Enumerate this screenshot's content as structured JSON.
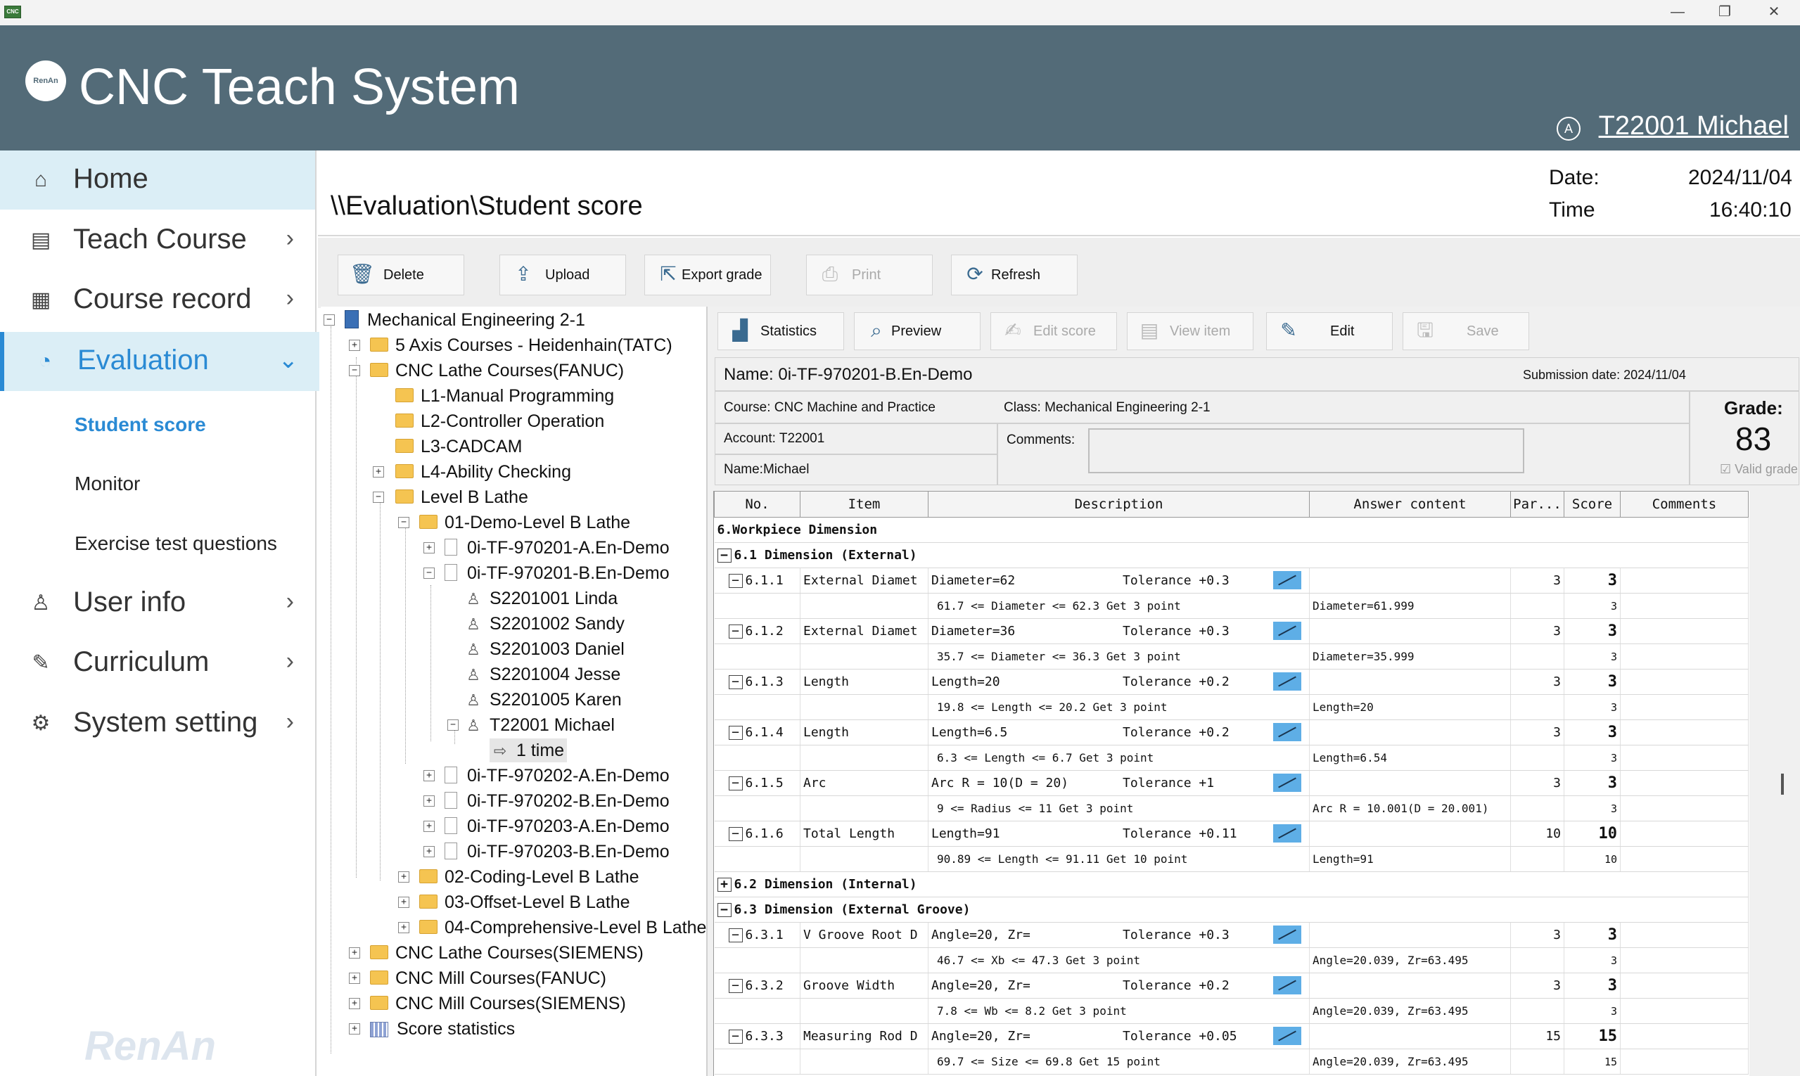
{
  "window": {
    "app_icon": "CNC",
    "minimize": "—",
    "restore": "❐",
    "close": "✕"
  },
  "header": {
    "title": "CNC Teach System",
    "logo_text": "RenAn",
    "user": "T22001 Michael",
    "user_icon": "A"
  },
  "sidebar": {
    "items": [
      {
        "label": "Home",
        "icon": "home-icon"
      },
      {
        "label": "Teach Course",
        "icon": "cnc-icon"
      },
      {
        "label": "Course record",
        "icon": "document-icon"
      },
      {
        "label": "Evaluation",
        "icon": "pie-chart-icon"
      },
      {
        "label": "User info",
        "icon": "user-icon"
      },
      {
        "label": "Curriculum",
        "icon": "pencil-icon"
      },
      {
        "label": "System setting",
        "icon": "gear-icon"
      }
    ],
    "sub_items": [
      "Student score",
      "Monitor",
      "Exercise test questions"
    ],
    "watermark": "RenAn"
  },
  "pathbar": {
    "path": "\\\\Evaluation\\Student score",
    "date_label": "Date:",
    "date_value": "2024/11/04",
    "time_label": "Time",
    "time_value": "16:40:10"
  },
  "toolbar": {
    "delete": "Delete",
    "upload": "Upload",
    "export": "Export grade",
    "print": "Print",
    "refresh": "Refresh"
  },
  "tree": {
    "root": "Mechanical Engineering 2-1",
    "n1": "5 Axis Courses - Heidenhain(TATC)",
    "n2": "CNC Lathe Courses(FANUC)",
    "n3": "L1-Manual Programming",
    "n4": "L2-Controller Operation",
    "n5": "L3-CADCAM",
    "n6": "L4-Ability Checking",
    "n7": "Level B Lathe",
    "n8": "01-Demo-Level B Lathe",
    "n9": "0i-TF-970201-A.En-Demo",
    "n10": "0i-TF-970201-B.En-Demo",
    "s1": "S2201001 Linda",
    "s2": "S2201002 Sandy",
    "s3": "S2201003 Daniel",
    "s4": "S2201004 Jesse",
    "s5": "S2201005 Karen",
    "s6": "T22001 Michael",
    "t1": "1 time",
    "n11": "0i-TF-970202-A.En-Demo",
    "n12": "0i-TF-970202-B.En-Demo",
    "n13": "0i-TF-970203-A.En-Demo",
    "n14": "0i-TF-970203-B.En-Demo",
    "n15": "02-Coding-Level B Lathe",
    "n16": "03-Offset-Level B Lathe",
    "n17": "04-Comprehensive-Level B Lathe",
    "n18": "CNC Lathe Courses(SIEMENS)",
    "n19": "CNC Mill Courses(FANUC)",
    "n20": "CNC Mill Courses(SIEMENS)",
    "n21": "Score statistics"
  },
  "right_toolbar": {
    "statistics": "Statistics",
    "preview": "Preview",
    "edit_score": "Edit score",
    "view_item": "View item",
    "edit": "Edit",
    "save": "Save"
  },
  "info": {
    "name": "Name: 0i-TF-970201-B.En-Demo",
    "submission": "Submission date: 2024/11/04",
    "course": "Course: CNC Machine and Practice",
    "class": "Class: Mechanical Engineering 2-1",
    "account": "Account: T22001",
    "comments_label": "Comments:",
    "student_name": "Name:Michael",
    "grade_label": "Grade:",
    "grade_value": "83",
    "valid_grade": "Valid grade"
  },
  "table": {
    "headers": [
      "No.",
      "Item",
      "Description",
      "Answer content",
      "Par...",
      "Score",
      "Comments"
    ],
    "section_6": "6.Workpiece Dimension",
    "section_61": "6.1 Dimension (External)",
    "section_62": "6.2 Dimension (Internal)",
    "section_63": "6.3 Dimension (External Groove)",
    "rows": [
      {
        "no": "6.1.1",
        "item": "External Diamet",
        "desc": "Diameter=62",
        "tol": "Tolerance +0.3",
        "par": "3",
        "score": "3",
        "sub": "61.7 <= Diameter <= 62.3 Get 3 point",
        "answer": "Diameter=61.999",
        "subscore": "3"
      },
      {
        "no": "6.1.2",
        "item": "External Diamet",
        "desc": "Diameter=36",
        "tol": "Tolerance +0.3",
        "par": "3",
        "score": "3",
        "sub": "35.7 <= Diameter <= 36.3 Get 3 point",
        "answer": "Diameter=35.999",
        "subscore": "3"
      },
      {
        "no": "6.1.3",
        "item": "Length",
        "desc": "Length=20",
        "tol": "Tolerance +0.2",
        "par": "3",
        "score": "3",
        "sub": "19.8 <= Length <= 20.2 Get 3 point",
        "answer": "Length=20",
        "subscore": "3"
      },
      {
        "no": "6.1.4",
        "item": "Length",
        "desc": "Length=6.5",
        "tol": "Tolerance +0.2",
        "par": "3",
        "score": "3",
        "sub": "6.3 <= Length <= 6.7 Get 3 point",
        "answer": "Length=6.54",
        "subscore": "3"
      },
      {
        "no": "6.1.5",
        "item": "Arc",
        "desc": "Arc R = 10(D = 20)",
        "tol": "Tolerance +1",
        "par": "3",
        "score": "3",
        "sub": "9 <= Radius <= 11 Get 3 point",
        "answer": "Arc R = 10.001(D = 20.001)",
        "subscore": "3"
      },
      {
        "no": "6.1.6",
        "item": "Total Length",
        "desc": "Length=91",
        "tol": "Tolerance +0.11",
        "par": "10",
        "score": "10",
        "sub": "90.89 <= Length <= 91.11 Get 10 point",
        "answer": "Length=91",
        "subscore": "10"
      }
    ],
    "rows63": [
      {
        "no": "6.3.1",
        "item": "V Groove Root D",
        "desc": "Angle=20, Zr=",
        "tol": "Tolerance +0.3",
        "par": "3",
        "score": "3",
        "sub": "46.7 <= Xb <= 47.3 Get 3 point",
        "answer": "Angle=20.039, Zr=63.495",
        "subscore": "3"
      },
      {
        "no": "6.3.2",
        "item": "Groove Width",
        "desc": "Angle=20, Zr=",
        "tol": "Tolerance +0.2",
        "par": "3",
        "score": "3",
        "sub": "7.8 <= Wb <= 8.2 Get 3 point",
        "answer": "Angle=20.039, Zr=63.495",
        "subscore": "3"
      },
      {
        "no": "6.3.3",
        "item": "Measuring Rod D",
        "desc": "Angle=20, Zr=",
        "tol": "Tolerance +0.05",
        "par": "15",
        "score": "15",
        "sub": "69.7 <= Size <= 69.8 Get 15 point",
        "answer": "Angle=20.039, Zr=63.495",
        "subscore": "15"
      }
    ]
  }
}
